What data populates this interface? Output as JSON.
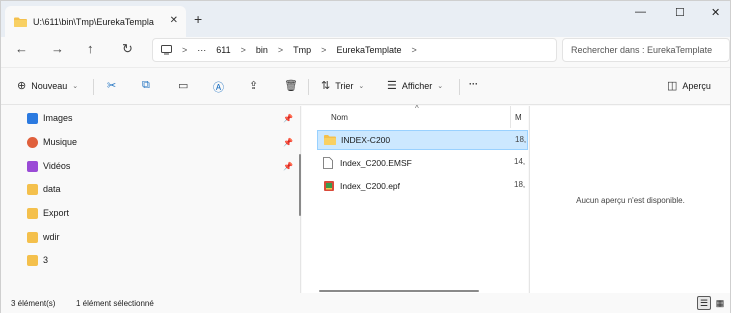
{
  "window": {
    "tab_title": "U:\\611\\bin\\Tmp\\EurekaTempla",
    "tab_close": "✕",
    "new_tab": "+",
    "min": "—",
    "max": "☐",
    "close": "✕"
  },
  "nav": {
    "back": "←",
    "forward": "→",
    "up": "↑",
    "refresh": "↻"
  },
  "address": {
    "overflow": "···",
    "crumbs": [
      "611",
      "bin",
      "Tmp",
      "EurekaTemplate"
    ],
    "separator": ">",
    "search_placeholder": "Rechercher dans : EurekaTemplate"
  },
  "toolbar": {
    "new_label": "Nouveau",
    "sort_label": "Trier",
    "view_label": "Afficher",
    "more": "···",
    "preview_label": "Aperçu"
  },
  "sidebar": {
    "items": [
      {
        "label": "Images",
        "icon": "images-icon",
        "pinned": true
      },
      {
        "label": "Musique",
        "icon": "music-icon",
        "pinned": true
      },
      {
        "label": "Vidéos",
        "icon": "videos-icon",
        "pinned": true
      },
      {
        "label": "data",
        "icon": "folder-icon"
      },
      {
        "label": "Export",
        "icon": "folder-icon"
      },
      {
        "label": "wdir",
        "icon": "folder-icon"
      },
      {
        "label": "3",
        "icon": "folder-icon"
      }
    ]
  },
  "filelist": {
    "col_name": "Nom",
    "col_modified": "M",
    "rows": [
      {
        "name": "INDEX-C200",
        "type": "folder",
        "date": "18,",
        "selected": true
      },
      {
        "name": "Index_C200.EMSF",
        "type": "file",
        "date": "14,",
        "selected": false
      },
      {
        "name": "Index_C200.epf",
        "type": "epf",
        "date": "18,",
        "selected": false
      }
    ]
  },
  "preview": {
    "message": "Aucun aperçu n'est disponible."
  },
  "status": {
    "count": "3 élément(s)",
    "selected": "1 élément sélectionné"
  },
  "colors": {
    "accent": "#0067c0",
    "selection": "#cce8ff",
    "folder": "#f4c04c"
  }
}
